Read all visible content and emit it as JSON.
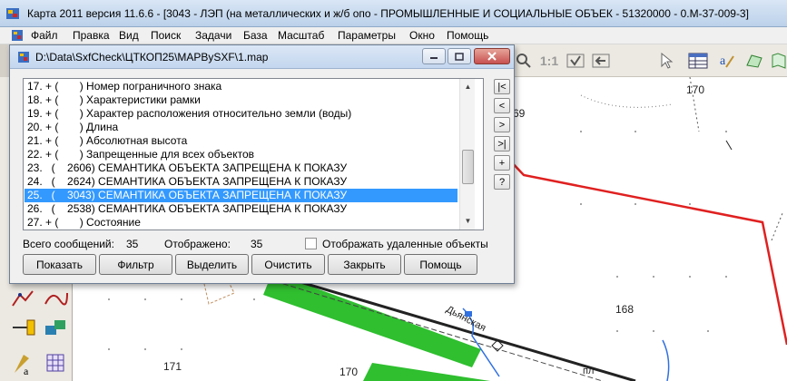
{
  "app": {
    "title": "Карта 2011 версия 11.6.6 - [3043 - ЛЭП (на металлических и ж/б опо - ПРОМЫШЛЕННЫЕ И СОЦИАЛЬНЫЕ ОБЪЕК - 51320000 - 0.M-37-009-3]"
  },
  "menu": [
    "Файл",
    "Правка",
    "Вид",
    "Поиск",
    "Задачи",
    "База",
    "Масштаб",
    "Параметры",
    "Окно",
    "Помощь"
  ],
  "toolbar": {
    "scale_label": "1:1"
  },
  "map": {
    "labels": [
      "170",
      "69",
      "168",
      "171",
      "170",
      "Дьянская",
      "пл"
    ]
  },
  "dialog": {
    "title": "D:\\Data\\SxfCheck\\ЦТКОП25\\MAPBySXF\\1.map",
    "rows": [
      "17. + (       ) Номер пограничного знака",
      "18. + (       ) Характеристики рамки",
      "19. + (       ) Характер расположения относительно земли (воды)",
      "20. + (       ) Длина",
      "21. + (       ) Абсолютная высота",
      "22. + (       ) Запрещенные для всех объектов",
      "23.   (    2606) СЕМАНТИКА ОБЪЕКТА ЗАПРЕЩЕНА К ПОКАЗУ",
      "24.   (    2624) СЕМАНТИКА ОБЪЕКТА ЗАПРЕЩЕНА К ПОКАЗУ",
      "25.   (    3043) СЕМАНТИКА ОБЪЕКТА ЗАПРЕЩЕНА К ПОКАЗУ",
      "26.   (    2538) СЕМАНТИКА ОБЪЕКТА ЗАПРЕЩЕНА К ПОКАЗУ",
      "27. + (       ) Состояние"
    ],
    "selected_row": 8,
    "nav": [
      "|<",
      "<",
      ">",
      ">|",
      "+",
      "?"
    ],
    "total_label": "Всего сообщений:",
    "total_value": "35",
    "shown_label": "Отображено:",
    "shown_value": "35",
    "show_deleted_label": "Отображать удаленные объекты",
    "show_deleted_checked": false,
    "buttons": {
      "show": "Показать",
      "filter": "Фильтр",
      "select": "Выделить",
      "clear": "Очистить",
      "close": "Закрыть",
      "help": "Помощь"
    }
  },
  "colors": {
    "selection": "#3399ff",
    "route_line": "#e02020",
    "vegetation": "#2fbf2f"
  }
}
